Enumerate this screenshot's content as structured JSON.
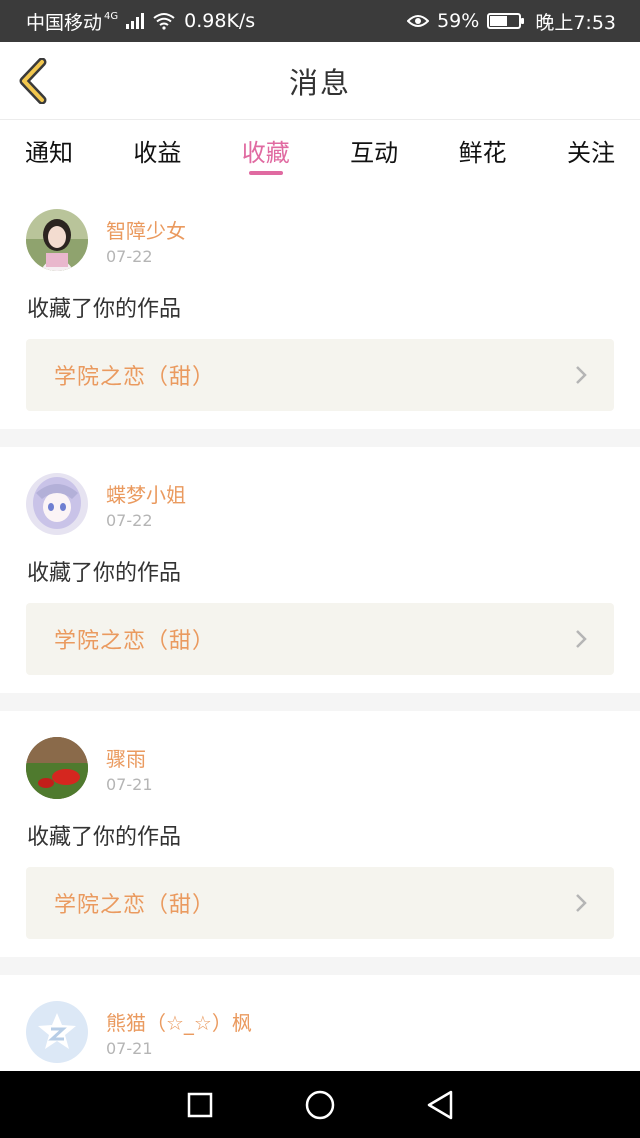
{
  "status_bar": {
    "carrier": "中国移动",
    "network": "4G",
    "speed": "0.98K/s",
    "battery": "59%",
    "battery_level": 0.59,
    "time": "晚上7:53"
  },
  "header": {
    "title": "消息"
  },
  "tabs": [
    {
      "label": "通知",
      "active": false
    },
    {
      "label": "收益",
      "active": false
    },
    {
      "label": "收藏",
      "active": true
    },
    {
      "label": "互动",
      "active": false
    },
    {
      "label": "鲜花",
      "active": false
    },
    {
      "label": "关注",
      "active": false
    }
  ],
  "messages": [
    {
      "user": "智障少女",
      "date": "07-22",
      "text": "收藏了你的作品",
      "work": "学院之恋（甜）"
    },
    {
      "user": "蝶梦小姐",
      "date": "07-22",
      "text": "收藏了你的作品",
      "work": "学院之恋（甜）"
    },
    {
      "user": "骤雨",
      "date": "07-21",
      "text": "收藏了你的作品",
      "work": "学院之恋（甜）"
    },
    {
      "user": "熊猫（☆_☆）枫",
      "date": "07-21"
    }
  ],
  "colors": {
    "accent_pink": "#e06aa1",
    "accent_orange": "#ea9a5f",
    "link_bg": "#f5f4ee",
    "status_bar_bg": "#3b3b3b"
  },
  "icons": {
    "back": "back-chevron-icon",
    "nav": [
      "recent-apps-icon",
      "home-icon",
      "back-triangle-icon"
    ]
  }
}
